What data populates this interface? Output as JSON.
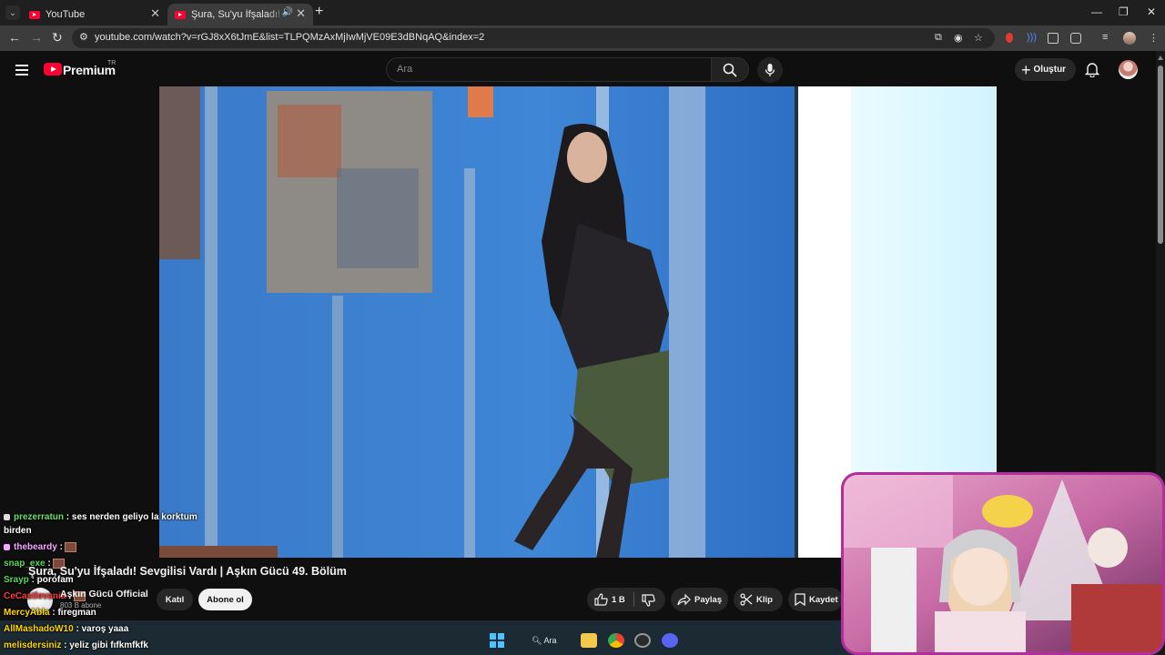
{
  "browser": {
    "tabs": [
      {
        "title": "YouTube",
        "active": false
      },
      {
        "title": "Şura, Su'yu İfşaladı! Sevgilisi",
        "active": true
      }
    ],
    "url": "youtube.com/watch?v=rGJ8xX6tJmE&list=TLPQMzAxMjIwMjVE09E3dBNqAQ&index=2"
  },
  "youtube": {
    "logo_text": "Premium",
    "region": "TR",
    "search_placeholder": "Ara",
    "create_label": "Oluştur"
  },
  "video_info": {
    "title": "Şura, Su'yu İfşaladı! Sevgilisi Vardı | Aşkın Gücü 49. Bölüm",
    "channel": "Aşkın Gücü Official",
    "subscribers": "803 B abone",
    "join_label": "Katıl",
    "subscribe_label": "Abone ol",
    "likes": "1 B",
    "share_label": "Paylaş",
    "clip_label": "Klip",
    "save_label": "Kaydet"
  },
  "chat": [
    {
      "user": "prezerratun",
      "text": ": ses nerden geliyo la korktum",
      "user_color": "#6dde6d"
    },
    {
      "user": "",
      "text": "birden",
      "user_color": "#ffffff"
    },
    {
      "user": "thebeardy",
      "text": ":",
      "user_color": "#f5a8ff"
    },
    {
      "user": "snap_exe",
      "text": ":",
      "user_color": "#5bd95b"
    },
    {
      "user": "Srayp",
      "text": ": porofam",
      "user_color": "#5bd95b"
    },
    {
      "user": "CeCastlevania",
      "text": ":",
      "user_color": "#ff3b3b"
    },
    {
      "user": "MercyAbla",
      "text": ": firegman",
      "user_color": "#ffd700"
    },
    {
      "user": "AllMashadoW10",
      "text": ": varoş yaaa",
      "user_color": "#ffd700"
    },
    {
      "user": "melisdersiniz",
      "text": ": yeliz gibi fıfkmfkfk",
      "user_color": "#ffd700"
    }
  ],
  "taskbar": {
    "search_label": "Ara"
  },
  "colors": {
    "accent_red": "#ff0033",
    "webcam_border": "#b32ca0",
    "video_wall": "#3b7fce"
  }
}
